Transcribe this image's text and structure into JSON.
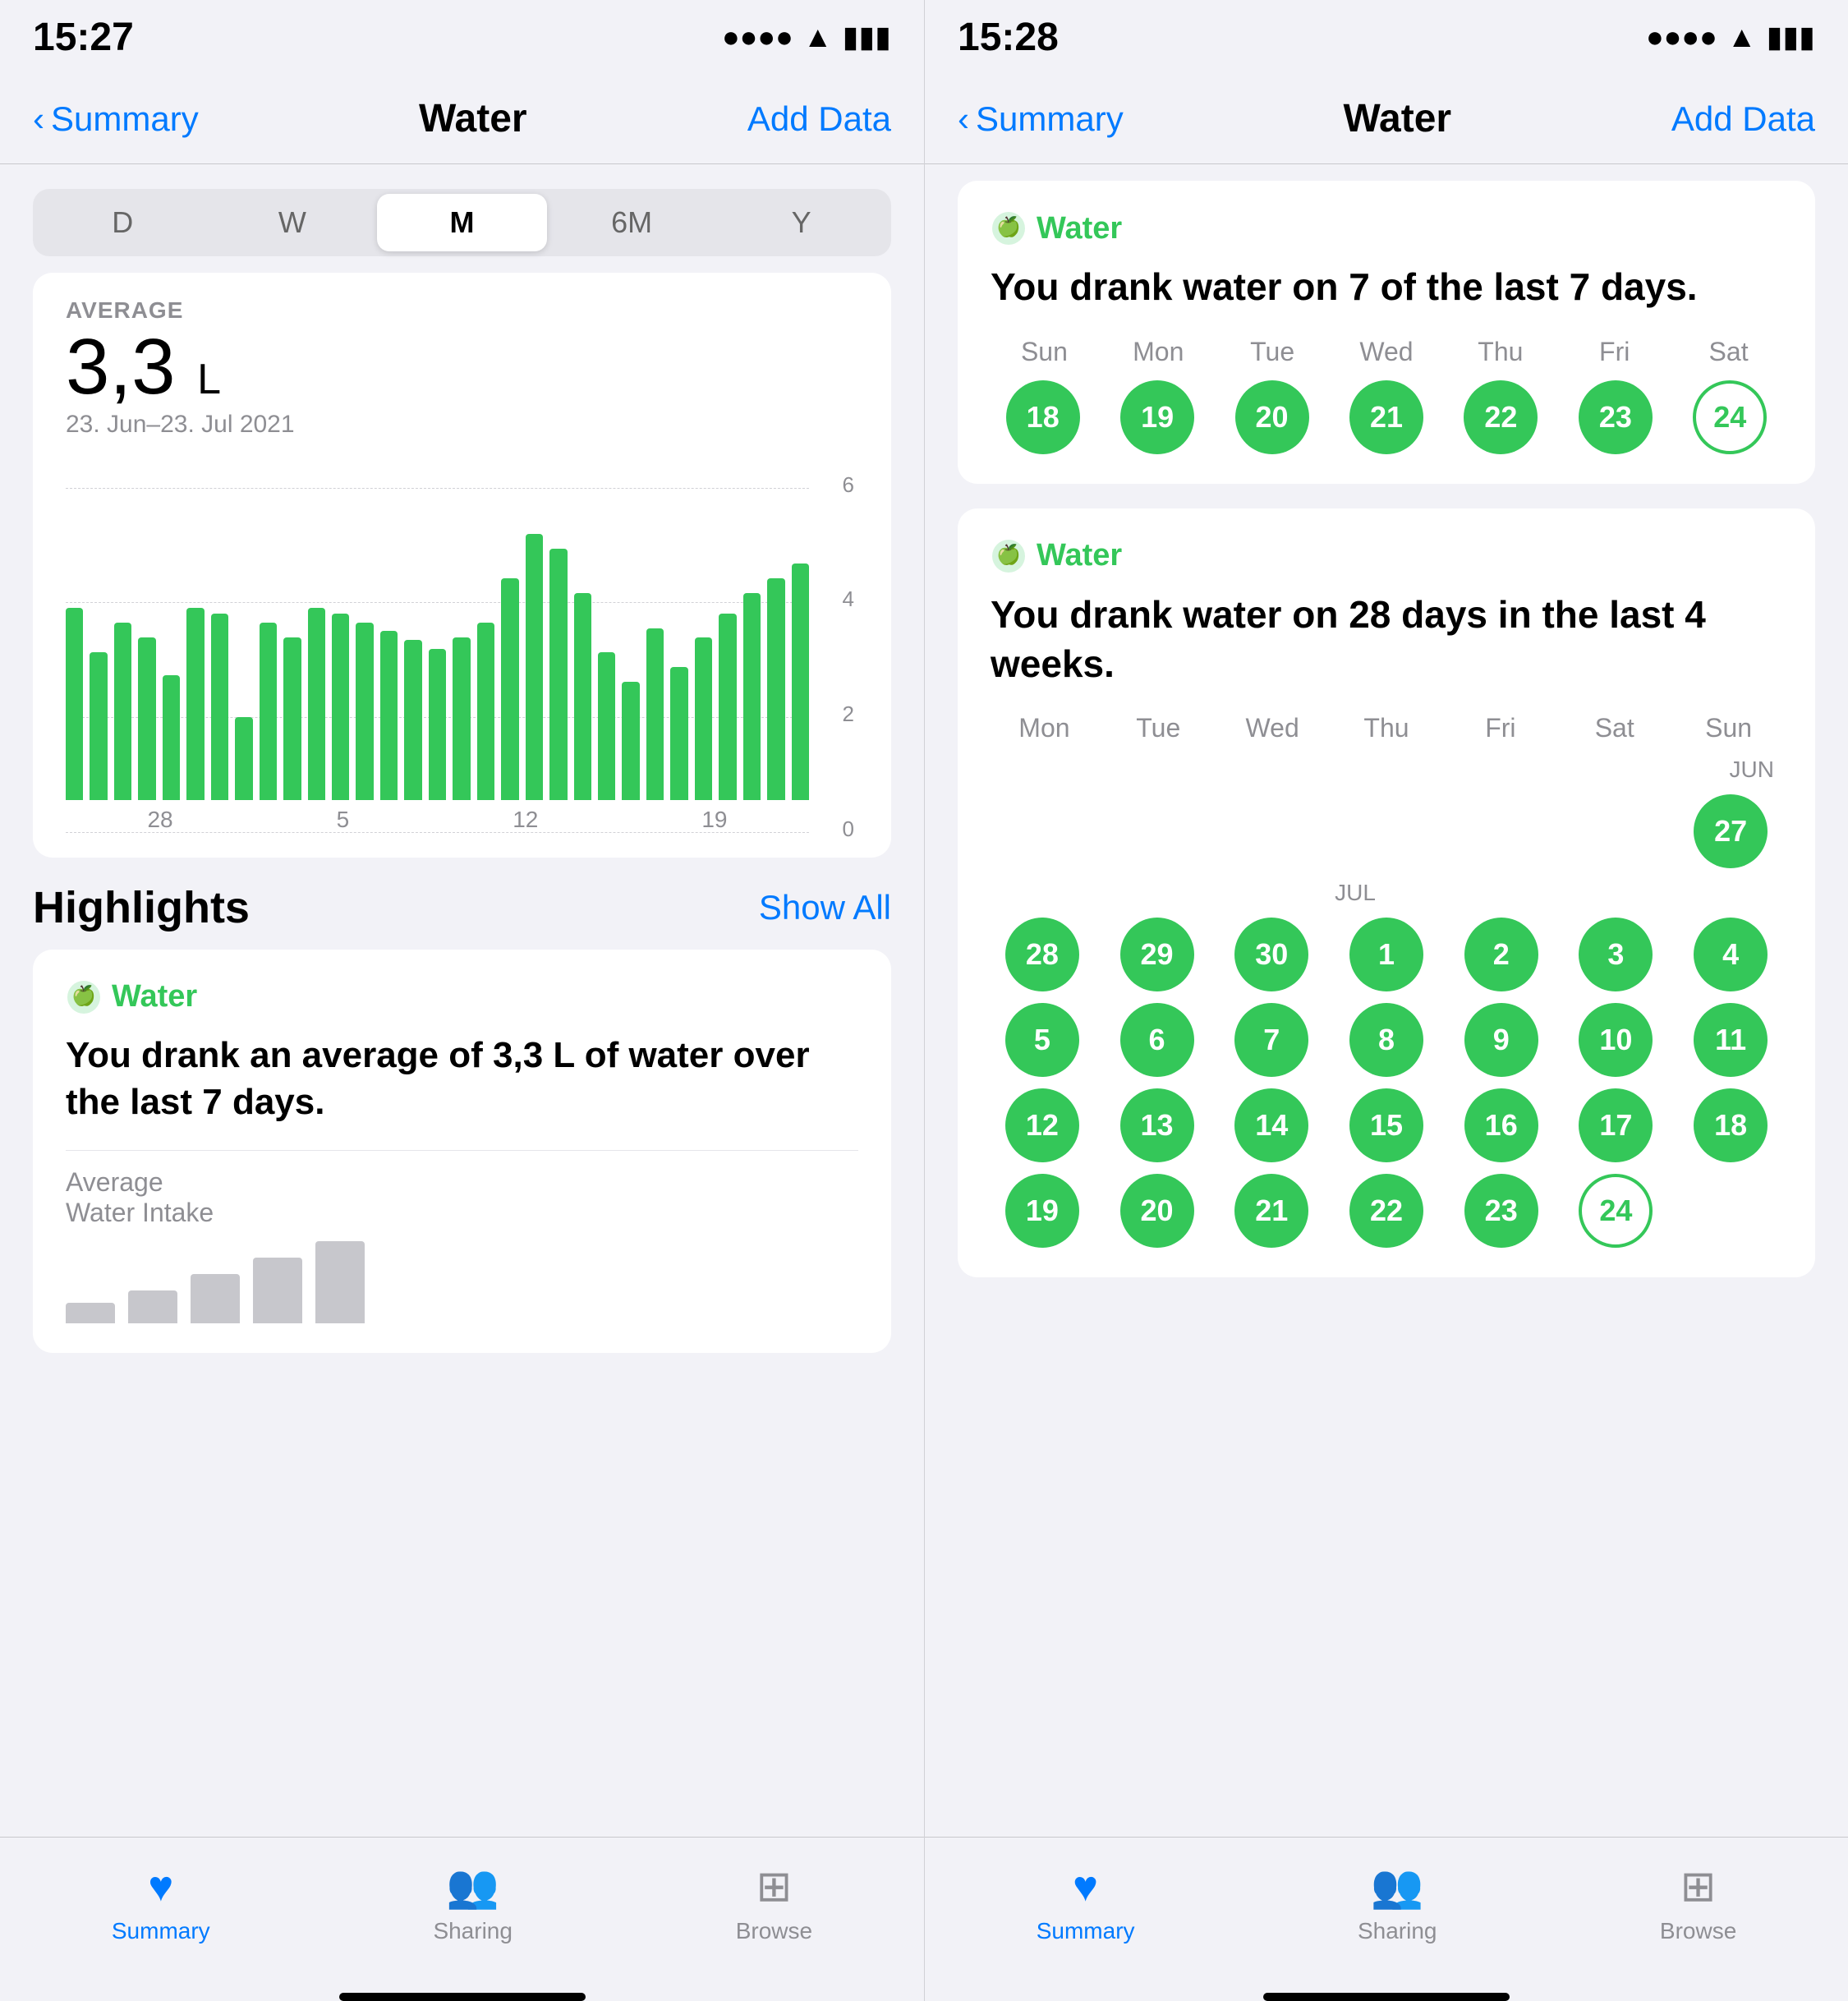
{
  "left": {
    "statusBar": {
      "time": "15:27",
      "locationIcon": "▶",
      "signalIcon": "📶",
      "wifiIcon": "📡",
      "batteryIcon": "🔋"
    },
    "navBar": {
      "backLabel": "Summary",
      "title": "Water",
      "actionLabel": "Add Data"
    },
    "segments": [
      "D",
      "W",
      "M",
      "6M",
      "Y"
    ],
    "activeSegment": 2,
    "chart": {
      "avgLabel": "AVERAGE",
      "value": "3,3",
      "unit": "L",
      "dateRange": "23. Jun–23. Jul 2021",
      "gridLabels": [
        "6",
        "4",
        "2",
        "0"
      ],
      "xLabels": [
        "28",
        "5",
        "12",
        "19"
      ],
      "bars": [
        70,
        55,
        65,
        60,
        45,
        70,
        68,
        30,
        65,
        60,
        70,
        68,
        65,
        62,
        58,
        55,
        60,
        65,
        70,
        68,
        75,
        85,
        80,
        68,
        55,
        60,
        65,
        70,
        68,
        80,
        75
      ],
      "maxVal": 6
    },
    "highlights": {
      "title": "Highlights",
      "showAll": "Show All",
      "card": {
        "waterLabel": "Water",
        "text": "You drank an average of 3,3 L of water over the last 7 days.",
        "subLabel": "Average\nWater Intake",
        "miniBars": [
          20,
          40,
          60,
          80,
          100
        ]
      }
    },
    "tabBar": {
      "tabs": [
        {
          "label": "Summary",
          "active": true
        },
        {
          "label": "Sharing",
          "active": false
        },
        {
          "label": "Browse",
          "active": false
        }
      ]
    }
  },
  "right": {
    "statusBar": {
      "time": "15:28",
      "locationIcon": "▶"
    },
    "navBar": {
      "backLabel": "Summary",
      "title": "Water",
      "actionLabel": "Add Data"
    },
    "card1": {
      "waterLabel": "Water",
      "title": "You drank water on 7 of the last 7 days.",
      "dayNames": [
        "Sun",
        "Mon",
        "Tue",
        "Wed",
        "Thu",
        "Fri",
        "Sat"
      ],
      "days": [
        18,
        19,
        20,
        21,
        22,
        23,
        24
      ],
      "todayDay": 24
    },
    "card2": {
      "waterLabel": "Water",
      "title": "You drank water on 28 days in the last 4 weeks.",
      "dayNames": [
        "Mon",
        "Tue",
        "Wed",
        "Thu",
        "Fri",
        "Sat",
        "Sun"
      ],
      "monthLabels": {
        "jun": "JUN",
        "jul": "JUL"
      },
      "weeks": [
        [
          null,
          null,
          null,
          null,
          null,
          null,
          27
        ],
        [
          28,
          29,
          30,
          1,
          2,
          3,
          4
        ],
        [
          5,
          6,
          7,
          8,
          9,
          10,
          11
        ],
        [
          12,
          13,
          14,
          15,
          16,
          17,
          18
        ],
        [
          19,
          20,
          21,
          22,
          23,
          24,
          null
        ]
      ],
      "todayDay": 24,
      "junDays": [
        27
      ],
      "julDays": [
        28,
        29,
        30,
        1,
        2,
        3,
        4,
        5,
        6,
        7,
        8,
        9,
        10,
        11,
        12,
        13,
        14,
        15,
        16,
        17,
        18,
        19,
        20,
        21,
        22,
        23,
        24
      ]
    },
    "tabBar": {
      "tabs": [
        {
          "label": "Summary",
          "active": true
        },
        {
          "label": "Sharing",
          "active": false
        },
        {
          "label": "Browse",
          "active": false
        }
      ]
    }
  }
}
